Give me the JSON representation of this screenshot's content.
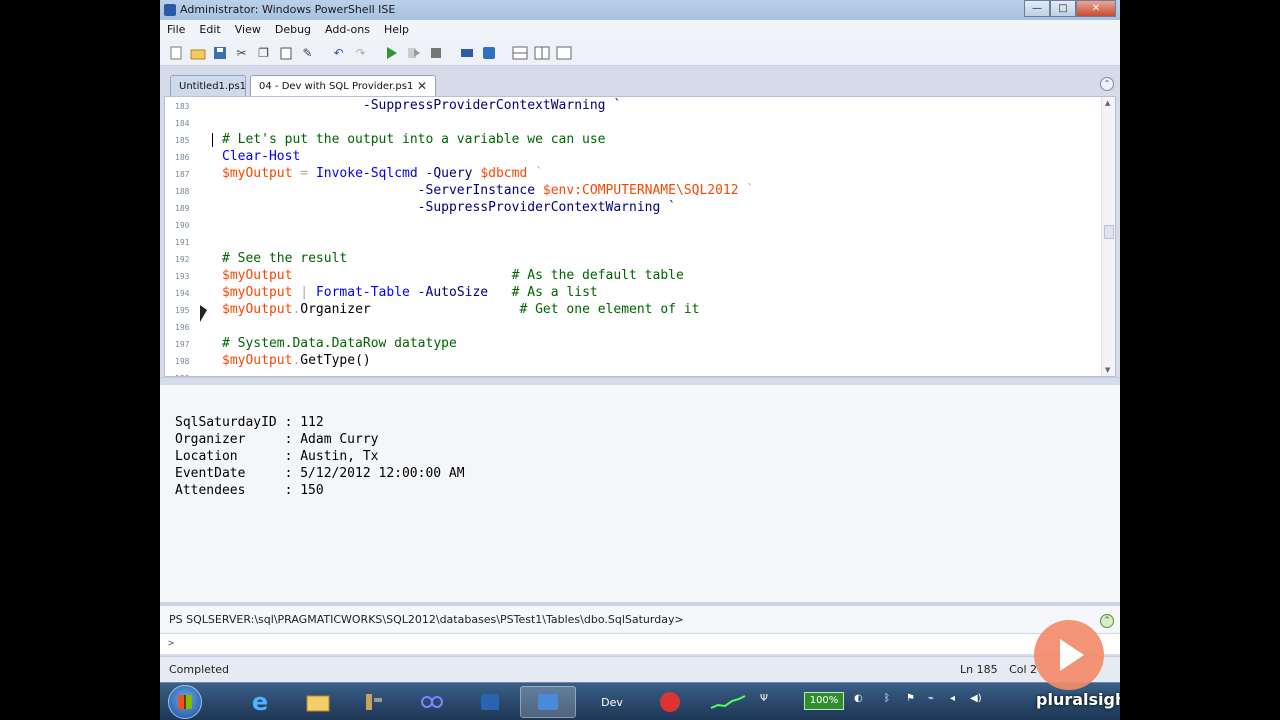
{
  "window": {
    "title": "Administrator: Windows PowerShell ISE"
  },
  "window_controls": {
    "minimize": "—",
    "maximize": "□",
    "close": "✕"
  },
  "menu": [
    "File",
    "Edit",
    "View",
    "Debug",
    "Add-ons",
    "Help"
  ],
  "toolbar_icons": [
    "new-icon",
    "open-icon",
    "save-icon",
    "cut-icon",
    "copy-icon",
    "paste-icon",
    "clear-icon",
    "undo-icon",
    "redo-icon",
    "run-icon",
    "run-selection-icon",
    "stop-icon",
    "remote-tab-icon",
    "start-powershell-icon",
    "layout-top-icon",
    "layout-right-icon",
    "layout-max-icon"
  ],
  "tabs": [
    {
      "label": "Untitled1.ps1"
    },
    {
      "label": "04 - Dev with SQL Provider.ps1",
      "close": "✕"
    }
  ],
  "editor": {
    "lines": [
      {
        "num": "183",
        "tokens": [
          {
            "t": "                  -SuppressProviderContextWarning `",
            "c": "prm"
          }
        ]
      },
      {
        "num": "184",
        "tokens": []
      },
      {
        "num": "185",
        "tokens": [
          {
            "t": "# Let's put the output into a variable we can use",
            "c": "cmt"
          }
        ]
      },
      {
        "num": "186",
        "tokens": [
          {
            "t": "Clear-Host",
            "c": "cmd"
          }
        ]
      },
      {
        "num": "187",
        "tokens": [
          {
            "t": "$myOutput",
            "c": "var"
          },
          {
            "t": " = ",
            "c": "op"
          },
          {
            "t": "Invoke-Sqlcmd",
            "c": "cmd"
          },
          {
            "t": " -Query ",
            "c": "prm"
          },
          {
            "t": "$dbcmd",
            "c": "var"
          },
          {
            "t": " `",
            "c": "op"
          }
        ]
      },
      {
        "num": "188",
        "tokens": [
          {
            "t": "                         -ServerInstance ",
            "c": "prm"
          },
          {
            "t": "$env:COMPUTERNAME\\SQL2012",
            "c": "var"
          },
          {
            "t": " `",
            "c": "op"
          }
        ]
      },
      {
        "num": "189",
        "tokens": [
          {
            "t": "                         -SuppressProviderContextWarning `",
            "c": "prm"
          }
        ]
      },
      {
        "num": "190",
        "tokens": []
      },
      {
        "num": "191",
        "tokens": []
      },
      {
        "num": "192",
        "tokens": [
          {
            "t": "# See the result",
            "c": "cmt"
          }
        ]
      },
      {
        "num": "193",
        "tokens": [
          {
            "t": "$myOutput",
            "c": "var"
          },
          {
            "t": "                            ",
            "c": "op"
          },
          {
            "t": "# As the default table",
            "c": "cmt"
          }
        ]
      },
      {
        "num": "194",
        "tokens": [
          {
            "t": "$myOutput",
            "c": "var"
          },
          {
            "t": " | ",
            "c": "op"
          },
          {
            "t": "Format-Table",
            "c": "cmd"
          },
          {
            "t": " -AutoSize",
            "c": "prm"
          },
          {
            "t": "   ",
            "c": "op"
          },
          {
            "t": "# As a list",
            "c": "cmt"
          }
        ]
      },
      {
        "num": "195",
        "tokens": [
          {
            "t": "$myOutput",
            "c": "var"
          },
          {
            "t": ".",
            "c": "op"
          },
          {
            "t": "Organizer",
            "c": "plain"
          },
          {
            "t": "                   ",
            "c": "op"
          },
          {
            "t": "# Get one element of it",
            "c": "cmt"
          }
        ]
      },
      {
        "num": "196",
        "tokens": []
      },
      {
        "num": "197",
        "tokens": [
          {
            "t": "# System.Data.DataRow datatype",
            "c": "cmt"
          }
        ]
      },
      {
        "num": "198",
        "tokens": [
          {
            "t": "$myOutput",
            "c": "var"
          },
          {
            "t": ".",
            "c": "op"
          },
          {
            "t": "GetType()",
            "c": "plain"
          }
        ]
      },
      {
        "num": "199",
        "tokens": []
      }
    ]
  },
  "output": [
    "SqlSaturdayID : 112",
    "Organizer     : Adam Curry",
    "Location      : Austin, Tx",
    "EventDate     : 5/12/2012 12:00:00 AM",
    "Attendees     : 150"
  ],
  "command_pane": {
    "prompt": "PS SQLSERVER:\\sql\\PRAGMATICWORKS\\SQL2012\\databases\\PSTest1\\Tables\\dbo.SqlSaturday>",
    "input": ">"
  },
  "status": {
    "text": "Completed",
    "line": "Ln 185",
    "col": "Col 2"
  },
  "taskbar": {
    "items": [
      "ie-icon",
      "explorer-icon",
      "tools-icon",
      "connector-icon",
      "powershell-icon",
      "ise-icon",
      "Dev",
      "recorder-icon",
      "network-graph-icon"
    ],
    "dev_label": "Dev",
    "battery": "100%"
  },
  "brand": {
    "name": "pluralsight"
  }
}
